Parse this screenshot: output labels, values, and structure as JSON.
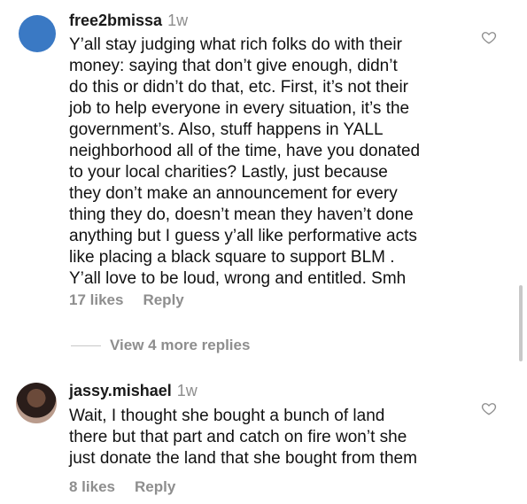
{
  "comments": [
    {
      "username": "free2bmissa",
      "time": "1w",
      "lines": [
        "Y’all stay judging what rich folks do with their",
        "money: saying that don’t give enough, didn’t",
        "do this or didn’t do that, etc. First, it’s not their",
        "job to help everyone in every situation, it’s the",
        "government’s. Also, stuff happens in YALL",
        "neighborhood all of the time, have you donated",
        "to your local charities? Lastly, just because",
        "they don’t make an announcement for every",
        "thing they do, doesn’t mean they haven’t done",
        "anything but I guess y’all like performative acts",
        "like placing a black square to support BLM .",
        "Y’all love to be loud, wrong and entitled. Smh"
      ],
      "likes": "17 likes",
      "reply": "Reply",
      "avatar_icon": "avatar-blue"
    },
    {
      "username": "jassy.mishael",
      "time": "1w",
      "lines": [
        "Wait, I thought she bought a bunch of land",
        "there but that part and catch on fire won’t she",
        "just donate the land that she bought from them"
      ],
      "likes": "8 likes",
      "reply": "Reply",
      "avatar_icon": "avatar-photo"
    }
  ],
  "view_more_replies": "View 4 more replies",
  "icons": {
    "like": "heart-icon"
  },
  "colors": {
    "text": "#111111",
    "muted": "#8e8e8e",
    "avatar_blue": "#3a79c4"
  }
}
